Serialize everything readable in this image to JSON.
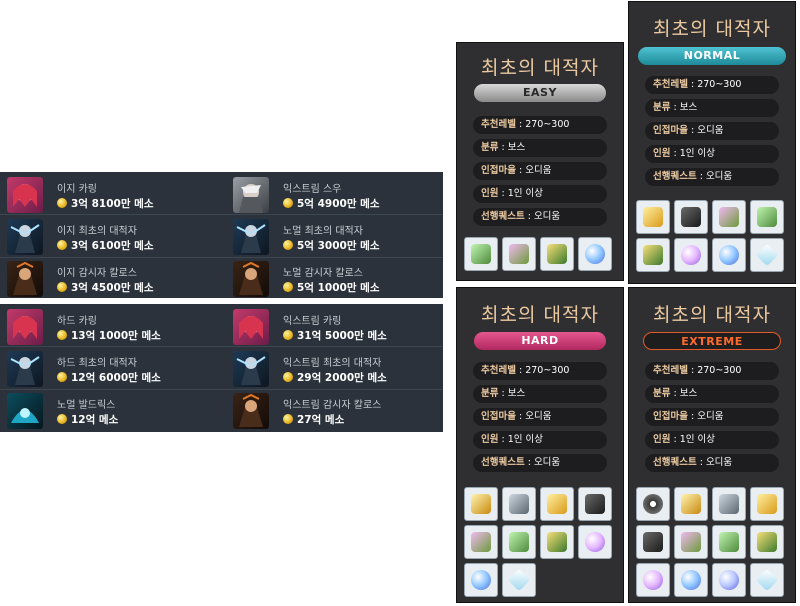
{
  "bosses_normal": [
    {
      "name": "이지 카링",
      "reward": "3억 8100만 메소",
      "icon": "karing-icon"
    },
    {
      "name": "익스트림 스우",
      "reward": "5억 4900만 메소",
      "icon": "suu-icon"
    },
    {
      "name": "이지 최초의 대적자",
      "reward": "3억 6100만 메소",
      "icon": "adversary-icon"
    },
    {
      "name": "노멀 최초의 대적자",
      "reward": "5억 3000만 메소",
      "icon": "adversary-icon"
    },
    {
      "name": "이지 감시자 칼로스",
      "reward": "3억 4500만 메소",
      "icon": "kalos-icon"
    },
    {
      "name": "노멀 감시자 칼로스",
      "reward": "5억 1000만 메소",
      "icon": "kalos-icon"
    }
  ],
  "bosses_hard": [
    {
      "name": "하드 카링",
      "reward": "13억 1000만 메소",
      "icon": "karing-icon"
    },
    {
      "name": "익스트림 카링",
      "reward": "31억 5000만 메소",
      "icon": "karing-icon"
    },
    {
      "name": "하드 최초의 대적자",
      "reward": "12억 6000만 메소",
      "icon": "adversary-icon"
    },
    {
      "name": "익스트림 최초의 대적자",
      "reward": "29억 2000만 메소",
      "icon": "adversary-icon"
    },
    {
      "name": "노멀 발드릭스",
      "reward": "12억 메소",
      "icon": "baldrix-icon"
    },
    {
      "name": "익스트림 감시자 칼로스",
      "reward": "27억 메소",
      "icon": "kalos-icon"
    }
  ],
  "panels": {
    "easy": {
      "title": "최초의 대적자",
      "difficulty": "EASY",
      "info": [
        {
          "k": "추천레벨",
          "v": " : 270~300"
        },
        {
          "k": "분류",
          "v": " : 보스"
        },
        {
          "k": "인접마을",
          "v": " : 오디움"
        },
        {
          "k": "인원",
          "v": " : 1인 이상"
        },
        {
          "k": "선행퀘스트",
          "v": " : 오디움"
        }
      ]
    },
    "normal": {
      "title": "최초의 대적자",
      "difficulty": "NORMAL",
      "info": [
        {
          "k": "추천레벨",
          "v": " : 270~300"
        },
        {
          "k": "분류",
          "v": " : 보스"
        },
        {
          "k": "인접마을",
          "v": " : 오디움"
        },
        {
          "k": "인원",
          "v": " : 1인 이상"
        },
        {
          "k": "선행퀘스트",
          "v": " : 오디움"
        }
      ]
    },
    "hard": {
      "title": "최초의 대적자",
      "difficulty": "HARD",
      "info": [
        {
          "k": "추천레벨",
          "v": " : 270~300"
        },
        {
          "k": "분류",
          "v": " : 보스"
        },
        {
          "k": "인접마을",
          "v": " : 오디움"
        },
        {
          "k": "인원",
          "v": " : 1인 이상"
        },
        {
          "k": "선행퀘스트",
          "v": " : 오디움"
        }
      ]
    },
    "extreme": {
      "title": "최초의 대적자",
      "difficulty": "EXTREME",
      "info": [
        {
          "k": "추천레벨",
          "v": " : 270~300"
        },
        {
          "k": "분류",
          "v": " : 보스"
        },
        {
          "k": "인접마을",
          "v": " : 오디움"
        },
        {
          "k": "인원",
          "v": " : 1인 이상"
        },
        {
          "k": "선행퀘스트",
          "v": " : 오디움"
        }
      ]
    }
  },
  "reward_icons": {
    "easy": [
      "gem-icon",
      "gem-icon",
      "box-icon",
      "orb-icon"
    ],
    "normal": [
      "gold-token-icon",
      "mask-icon",
      "gem-icon",
      "gem-icon",
      "box-icon",
      "orb-icon",
      "orb-icon",
      "crystal-icon"
    ],
    "hard": [
      "gold-emblem-icon",
      "chest-icon",
      "gold-token-icon",
      "mask-icon",
      "gem-icon",
      "gem-icon",
      "box-icon",
      "orb-icon",
      "orb-icon",
      "crystal-icon"
    ],
    "extreme": [
      "gear-icon",
      "gold-emblem-icon",
      "chest-icon",
      "gold-token-icon",
      "mask-icon",
      "gem-icon",
      "gem-icon",
      "box-icon",
      "orb-icon",
      "orb-icon",
      "orb-icon",
      "crystal-icon"
    ]
  },
  "colors": {
    "panel_bg": "#2f2f31",
    "label": "#ebc9a0",
    "strip_bg": "#2b323b"
  }
}
